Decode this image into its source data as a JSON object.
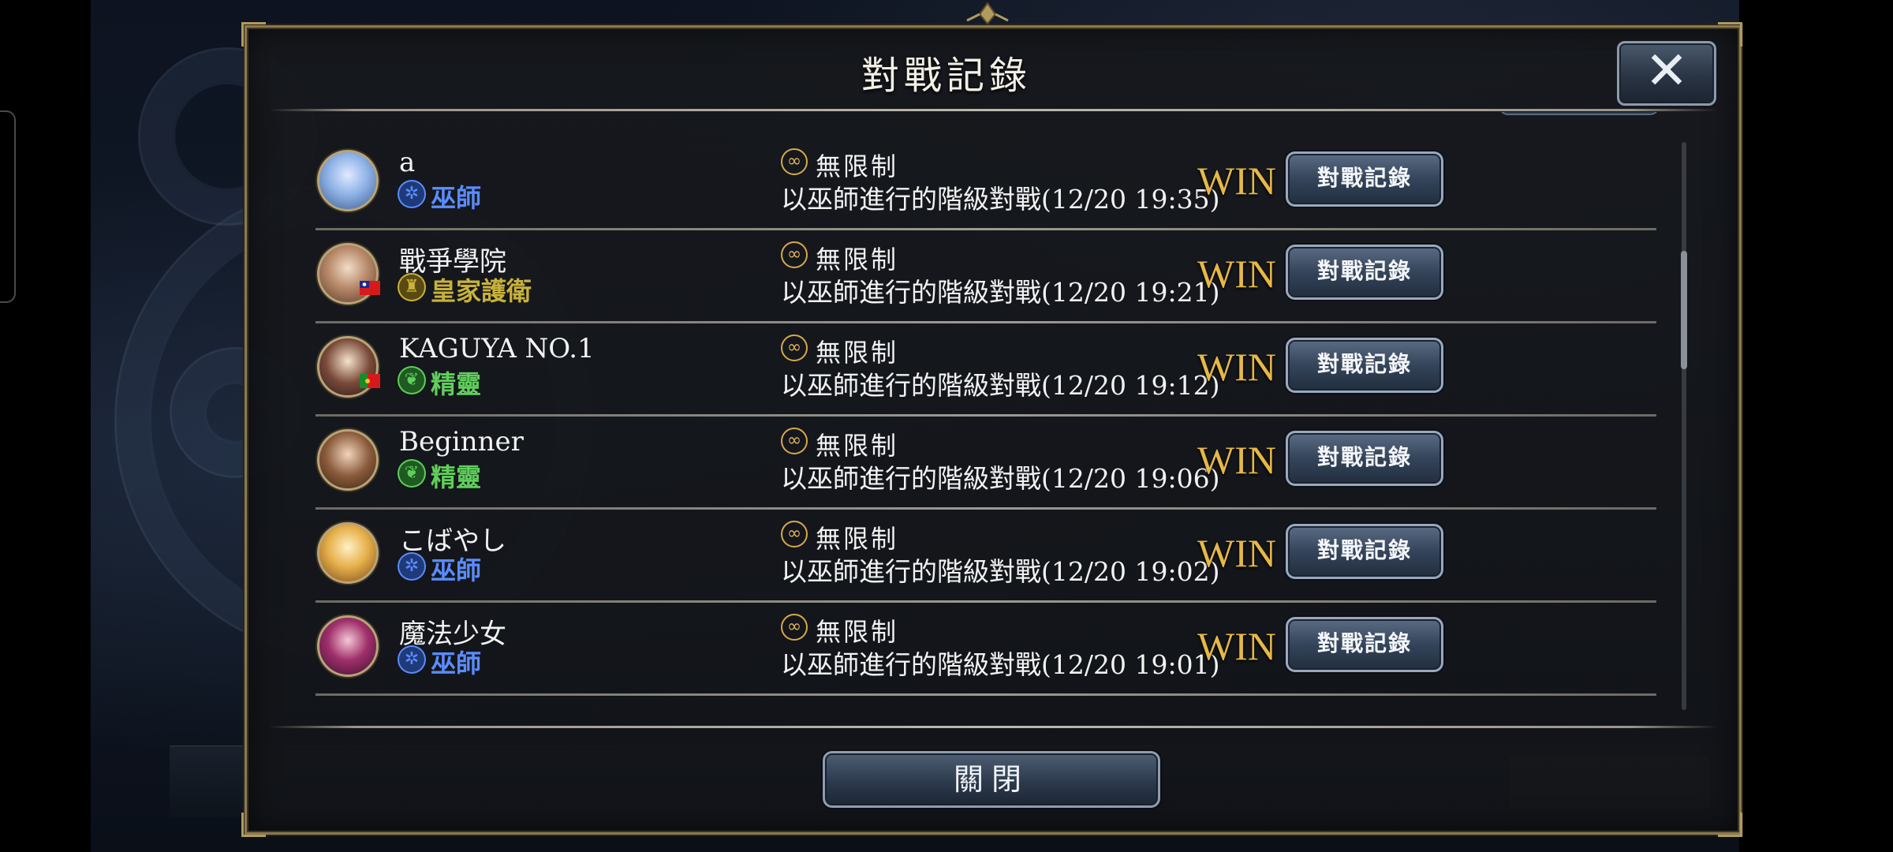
{
  "dialog": {
    "title": "對戰記錄",
    "close_icon": "close-icon",
    "close_button_label": "關閉"
  },
  "colors": {
    "win": "#e7b847",
    "witch_class": "#5a8cff",
    "royal_class": "#c9b23a",
    "elf_class": "#5fcf5a",
    "frame_gold": "#8b7a4e"
  },
  "records": [
    {
      "name": "a",
      "class_label": "巫師",
      "class_icon": "witch-icon",
      "format_label": "無限制",
      "description": "以巫師進行的階級對戰(12/20 19:35)",
      "result": "WIN",
      "button_label": "對戰記錄"
    },
    {
      "name": "戰爭學院",
      "class_label": "皇家護衛",
      "class_icon": "royal-icon",
      "format_label": "無限制",
      "description": "以巫師進行的階級對戰(12/20 19:21)",
      "result": "WIN",
      "button_label": "對戰記錄"
    },
    {
      "name": "KAGUYA NO.1",
      "class_label": "精靈",
      "class_icon": "elf-icon",
      "format_label": "無限制",
      "description": "以巫師進行的階級對戰(12/20 19:12)",
      "result": "WIN",
      "button_label": "對戰記錄"
    },
    {
      "name": "Beginner",
      "class_label": "精靈",
      "class_icon": "elf-icon",
      "format_label": "無限制",
      "description": "以巫師進行的階級對戰(12/20 19:06)",
      "result": "WIN",
      "button_label": "對戰記錄"
    },
    {
      "name": "こばやし",
      "class_label": "巫師",
      "class_icon": "witch-icon",
      "format_label": "無限制",
      "description": "以巫師進行的階級對戰(12/20 19:02)",
      "result": "WIN",
      "button_label": "對戰記錄"
    },
    {
      "name": "魔法少女",
      "class_label": "巫師",
      "class_icon": "witch-icon",
      "format_label": "無限制",
      "description": "以巫師進行的階級對戰(12/20 19:01)",
      "result": "WIN",
      "button_label": "對戰記錄"
    }
  ]
}
